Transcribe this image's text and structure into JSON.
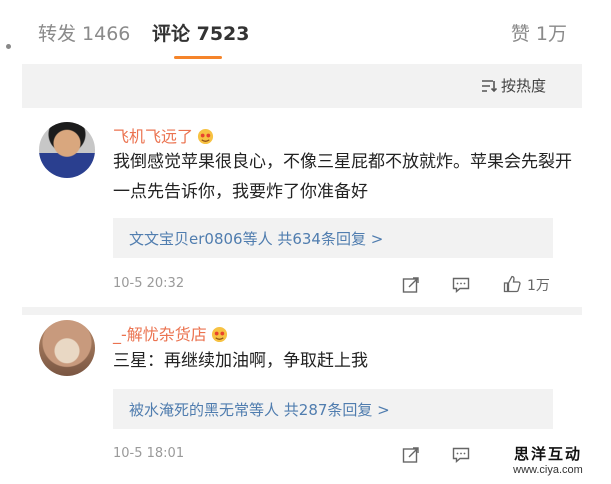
{
  "tabs": {
    "repost": "转发 1466",
    "comment": "评论 7523",
    "like": "赞 1万"
  },
  "sort_label": "按热度",
  "comments": [
    {
      "username": "飞机飞远了",
      "text": "我倒感觉苹果很良心，不像三星屁都不放就炸。苹果会先裂开一点先告诉你，我要炸了你准备好",
      "reply_summary": "文文宝贝er0806等人  共634条回复 >",
      "time": "10-5 20:32",
      "likes": "1万"
    },
    {
      "username": "_-解忧杂货店",
      "text": "三星：再继续加油啊，争取赶上我",
      "reply_summary": "被水淹死的黑无常等人  共287条回复 >",
      "time": "10-5 18:01"
    }
  ],
  "watermark": {
    "line1": "思洋互动",
    "line2": "www.ciya.com"
  },
  "colors": {
    "accent_orange": "#f5842a",
    "username": "#eb7350",
    "link_blue": "#507daf",
    "band_gray": "#f2f2f2"
  }
}
